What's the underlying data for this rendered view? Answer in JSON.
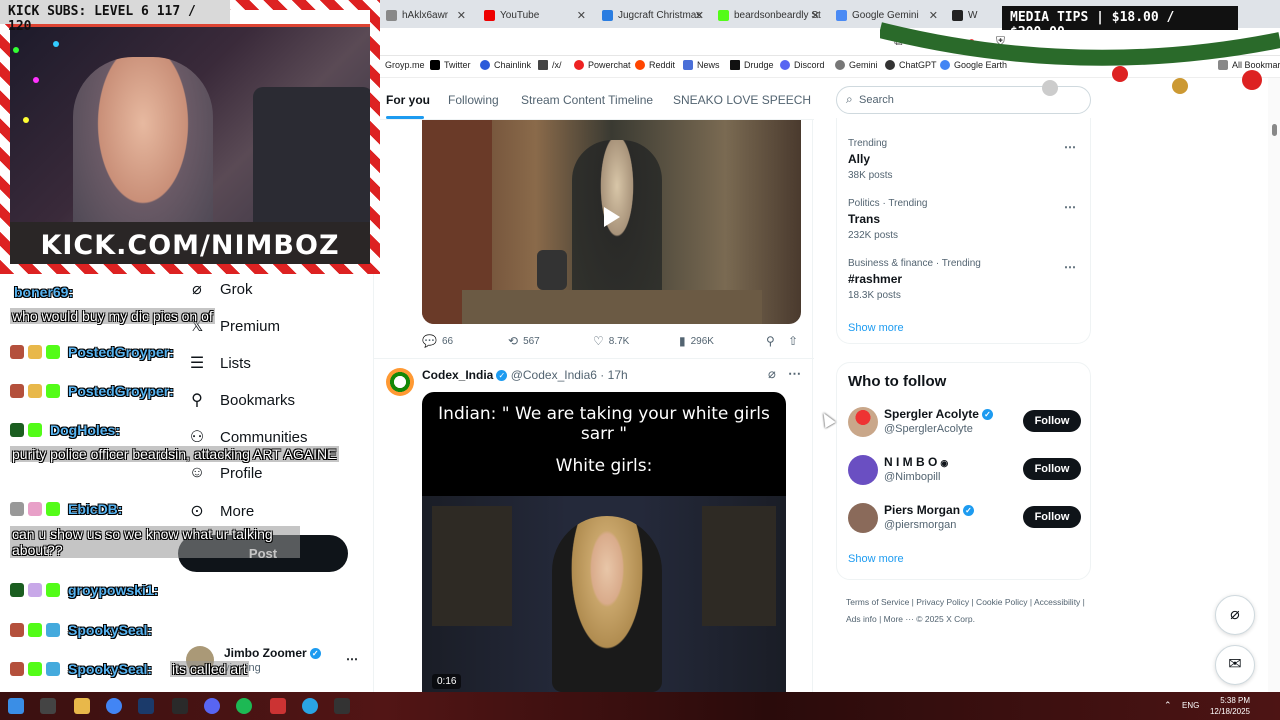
{
  "overlay": {
    "kick_subs": "KICK SUBS: LEVEL 6 117 / 120",
    "media_tips": "MEDIA TIPS | $18.00 / $200.00",
    "kick_url": "KICK.COM/NIMBOZ"
  },
  "chat": [
    {
      "user": "boner69:",
      "message": "who would buy my dic pics on of"
    },
    {
      "user": "PostedGroyper:",
      "message": ""
    },
    {
      "user": "PostedGroyper:",
      "message": ""
    },
    {
      "user": "DogHoles:",
      "message": "purity police officer beardsin, attacking ART AGAINE"
    },
    {
      "user": "EbicDB:",
      "message": "can u show us so we know what ur talking about??"
    },
    {
      "user": "groypowski1:",
      "message": ""
    },
    {
      "user": "SpookySeal:",
      "message": ""
    },
    {
      "user": "SpookySeal:",
      "message": "its called art"
    }
  ],
  "browser": {
    "tabs": [
      {
        "label": "hAklx6awr",
        "color": "#888"
      },
      {
        "label": "YouTube",
        "color": "#e00"
      },
      {
        "label": "Jugcraft Christmas",
        "color": "#2a7de1"
      },
      {
        "label": "beardsonbeardly St",
        "color": "#53fc18"
      },
      {
        "label": "Google Gemini",
        "color": "#4a8af4"
      },
      {
        "label": "W",
        "color": "#222"
      }
    ],
    "bookmarks": [
      "Groyp.me",
      "Twitter",
      "Chainlink",
      "/x/",
      "Powerchat",
      "Reddit",
      "News",
      "Drudge",
      "Discord",
      "Gemini",
      "ChatGPT",
      "Google Earth"
    ],
    "all_bookmarks": "All Bookmarks"
  },
  "nav": {
    "items": [
      {
        "label": "Grok",
        "icon": "grok-icon",
        "glyph": "⌀"
      },
      {
        "label": "Premium",
        "icon": "x-icon",
        "glyph": "𝕏"
      },
      {
        "label": "Lists",
        "icon": "list-icon",
        "glyph": "☰"
      },
      {
        "label": "Bookmarks",
        "icon": "bookmark-icon",
        "glyph": "🔖"
      },
      {
        "label": "Communities",
        "icon": "communities-icon",
        "glyph": "👥"
      },
      {
        "label": "Profile",
        "icon": "profile-icon",
        "glyph": "👤"
      },
      {
        "label": "More",
        "icon": "more-icon",
        "glyph": "⋯"
      }
    ],
    "post": "Post",
    "profile_name": "Jimbo Zoomer",
    "profile_sub": "viewing"
  },
  "feed": {
    "tabs": [
      "For you",
      "Following",
      "Stream Content Timeline",
      "SNEAKO LOVE SPEECH"
    ],
    "post1": {
      "replies": "66",
      "reposts": "567",
      "likes": "8.7K",
      "views": "296K"
    },
    "post2": {
      "name": "Codex_India",
      "handle": "@Codex_India6",
      "time": "17h",
      "caption": "Indian: \" We are taking your white girls sarr \"",
      "subcaption": "White girls:",
      "duration": "0:16"
    }
  },
  "right": {
    "search_placeholder": "Search",
    "trends": [
      {
        "meta": "Trending",
        "name": "Ally",
        "count": "38K posts"
      },
      {
        "meta": "Politics · Trending",
        "name": "Trans",
        "count": "232K posts"
      },
      {
        "meta": "Business & finance · Trending",
        "name": "#rashmer",
        "count": "18.3K posts"
      }
    ],
    "show_more": "Show more",
    "who_title": "Who to follow",
    "who": [
      {
        "name": "Spergler Acolyte",
        "handle": "@SperglerAcolyte",
        "verified": true,
        "color": "#c9a78a"
      },
      {
        "name": "N I M B O",
        "handle": "@Nimbopill",
        "verified": false,
        "color": "#6a4fc2"
      },
      {
        "name": "Piers Morgan",
        "handle": "@piersmorgan",
        "verified": true,
        "color": "#8a6a5a"
      }
    ],
    "follow": "Follow",
    "footer": "Terms of Service  |  Privacy Policy  |  Cookie Policy  |  Accessibility  |  Ads info  |  More ···  © 2025 X Corp."
  },
  "taskbar": {
    "lang": "ENG",
    "time": "5:38 PM",
    "date": "12/18/2025"
  }
}
